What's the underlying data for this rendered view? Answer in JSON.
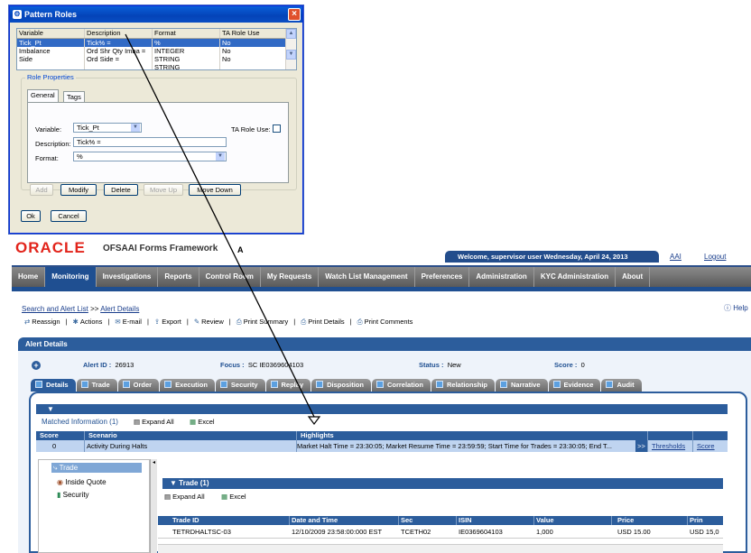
{
  "dialog": {
    "title": "Pattern Roles",
    "columns": [
      "Variable",
      "Description",
      "Format",
      "TA Role Use"
    ],
    "rows": [
      [
        "Tick_Pt",
        "Tick% =",
        "%",
        "No"
      ],
      [
        "Imbalance",
        "Ord Shr Qty Imba =",
        "INTEGER",
        "No"
      ],
      [
        "Side",
        "Ord Side =",
        "STRING",
        "No"
      ],
      [
        "",
        "",
        "STRING",
        ""
      ]
    ],
    "role_properties": "Role Properties",
    "tab_general": "General",
    "tab_tags": "Tags",
    "variable_label": "Variable:",
    "variable_value": "Tick_Pt",
    "ta_role_use_label": "TA Role Use:",
    "description_label": "Description:",
    "description_value": "Tick% =",
    "format_label": "Format:",
    "format_value": "%",
    "buttons": {
      "add": "Add",
      "modify": "Modify",
      "delete": "Delete",
      "move_up": "Move Up",
      "move_down": "Move Down",
      "ok": "Ok",
      "cancel": "Cancel"
    }
  },
  "annotation": "A",
  "app": {
    "logo": "ORACLE",
    "framework": "OFSAAI Forms Framework",
    "welcome": "Welcome, supervisor user  Wednesday, April 24, 2013",
    "aai": "AAI",
    "logout": "Logout",
    "help": "Help",
    "nav": [
      "Home",
      "Monitoring",
      "Investigations",
      "Reports",
      "Control Room",
      "My Requests",
      "Watch List Management",
      "Preferences",
      "Administration",
      "KYC Administration",
      "About"
    ],
    "breadcrumb": {
      "link": "Search and Alert List",
      "sep": ">>",
      "current": "Alert Details"
    },
    "actions": [
      "Reassign",
      "Actions",
      "E-mail",
      "Export",
      "Review",
      "Print Summary",
      "Print Details",
      "Print Comments"
    ],
    "alert_header": "Alert Details",
    "alert_id_label": "Alert ID :",
    "alert_id": "26913",
    "focus_label": "Focus :",
    "focus": "SC IE0369604103",
    "status_label": "Status :",
    "status": "New",
    "score_label": "Score :",
    "score": "0",
    "tabs": [
      "Details",
      "Trade",
      "Order",
      "Execution",
      "Security",
      "Replay",
      "Disposition",
      "Correlation",
      "Relationship",
      "Narrative",
      "Evidence",
      "Audit"
    ],
    "matched": {
      "label": "Matched Information",
      "count": "(1)",
      "expand_all": "Expand All",
      "excel": "Excel",
      "headers": [
        "Score",
        "Scenario",
        "Highlights",
        "",
        ""
      ],
      "row": {
        "score": "0",
        "scenario": "Activity During Halts",
        "highlights": "Market Halt Time = 23:30:05; Market Resume Time = 23:59:59; Start Time for Trades = 23:30:05; End T...",
        "more": ">>",
        "thresholds": "Thresholds",
        "score_link": "Score"
      }
    },
    "tree": {
      "trade": "Trade",
      "inside_quote": "Inside Quote",
      "security": "Security"
    },
    "trade_panel": {
      "title": "Trade (1)",
      "expand_all": "Expand All",
      "excel": "Excel",
      "headers": [
        "Trade ID",
        "Date and Time",
        "Sec",
        "ISIN",
        "Value",
        "Price",
        "Prin"
      ],
      "row": [
        "TETRDHALTSC-03",
        "12/10/2009 23:58:00:000 EST",
        "TCETH02",
        "IE0369604103",
        "1,000",
        "USD 15.00",
        "USD 15,0"
      ]
    }
  }
}
